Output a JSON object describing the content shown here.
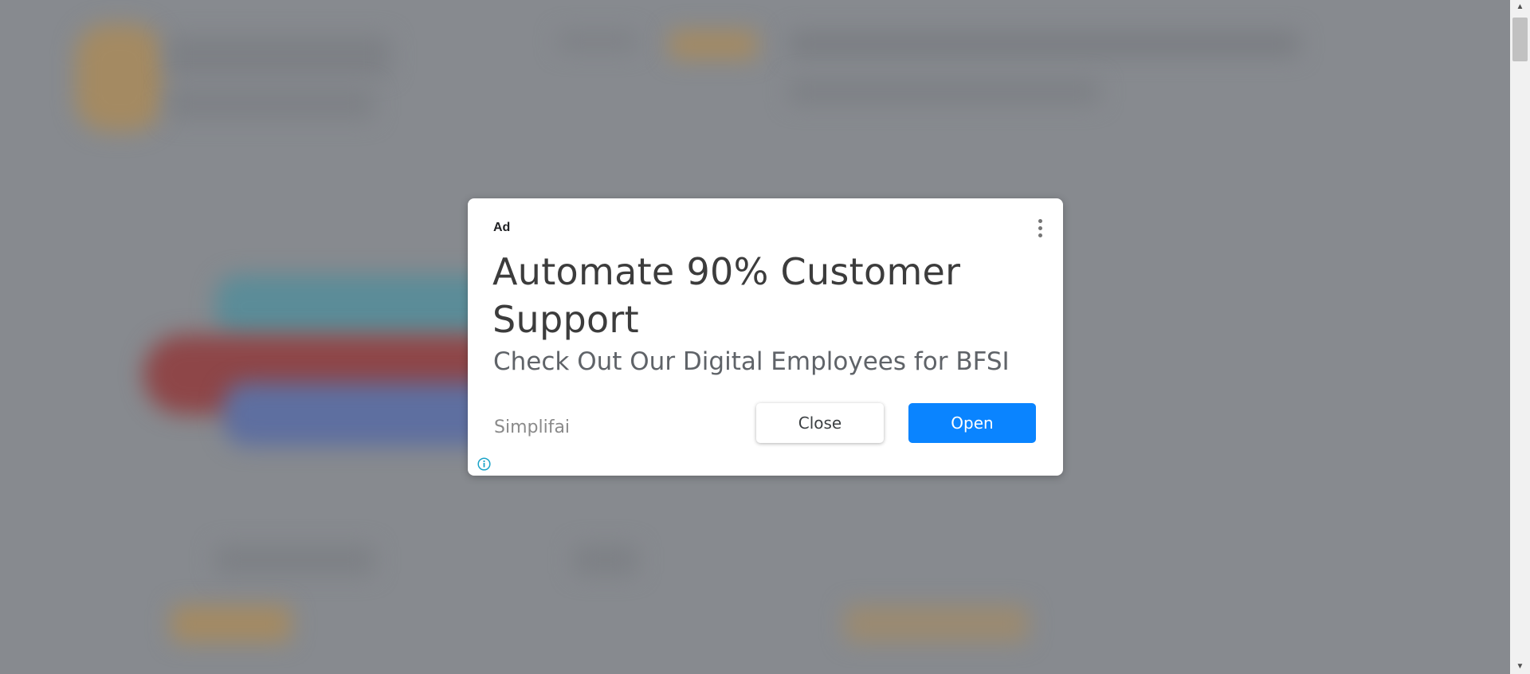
{
  "ad": {
    "label": "Ad",
    "headline": "Automate 90% Customer Support",
    "description": "Check Out Our Digital Employees for BFSI",
    "advertiser": "Simplifai",
    "close_label": "Close",
    "open_label": "Open",
    "menu_icon": "more-vert-icon",
    "info_icon": "info-icon"
  },
  "colors": {
    "open_button": "#0a84ff",
    "overlay": "#878a8f",
    "info_icon": "#1aa3c8"
  }
}
